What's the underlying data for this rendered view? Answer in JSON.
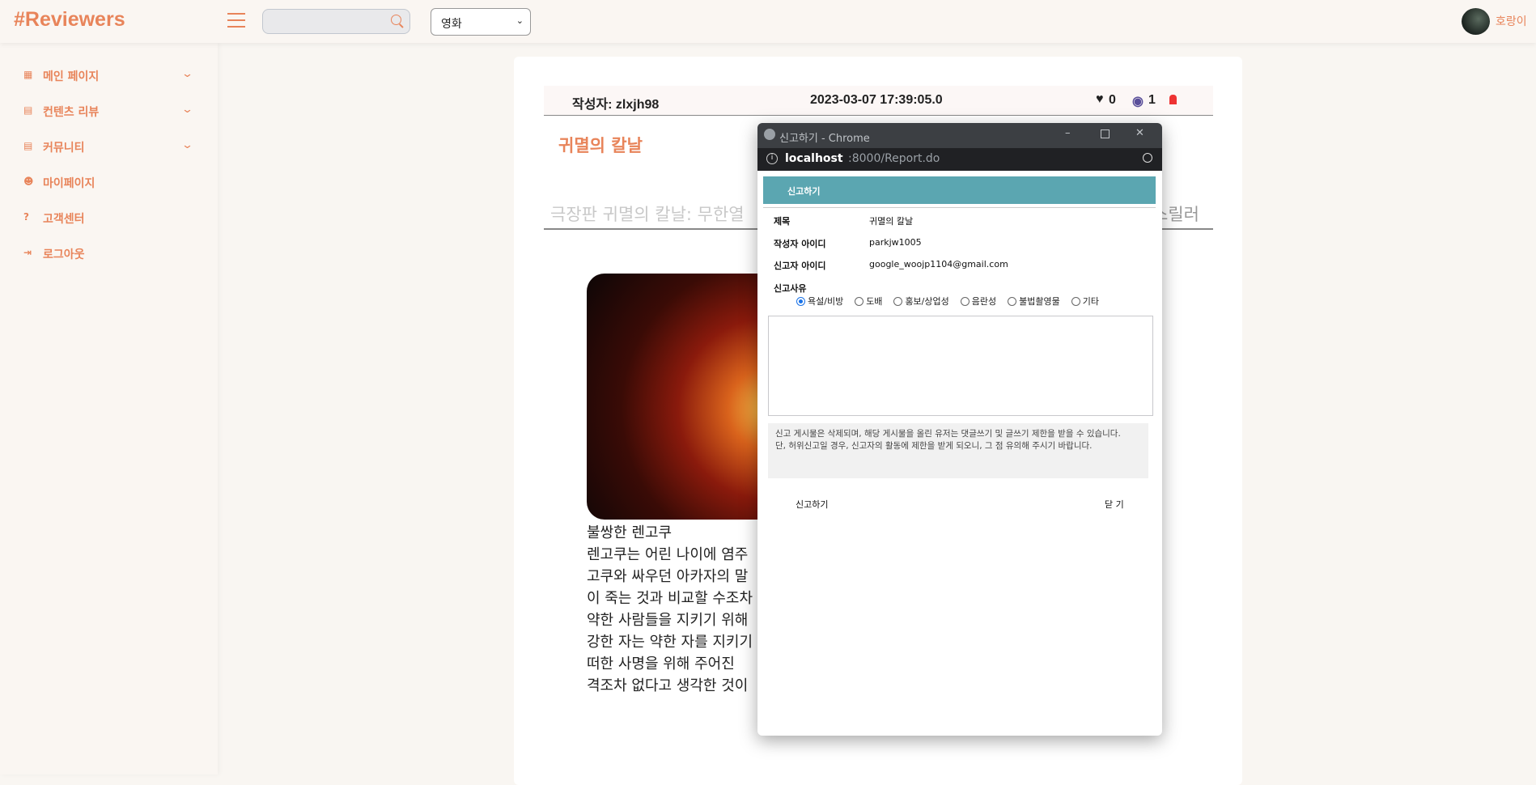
{
  "header": {
    "logo": "#Reviewers",
    "search_placeholder": "",
    "category": "영화",
    "user_name": "호랑이"
  },
  "sidebar": {
    "items": [
      {
        "label": "메인 페이지",
        "icon": "grid-icon",
        "has_submenu": true
      },
      {
        "label": "컨텐츠 리뷰",
        "icon": "list-icon",
        "has_submenu": true
      },
      {
        "label": "커뮤니티",
        "icon": "notebook-icon",
        "has_submenu": true
      },
      {
        "label": "마이페이지",
        "icon": "user-icon",
        "has_submenu": false
      },
      {
        "label": "고객센터",
        "icon": "help-icon",
        "has_submenu": false
      },
      {
        "label": "로그아웃",
        "icon": "logout-icon",
        "has_submenu": false
      }
    ]
  },
  "post": {
    "author": "작성자: zlxjh98",
    "date": "2023-03-07 17:39:05.0",
    "likes": "0",
    "views": "1",
    "title": "귀멸의 칼날",
    "subtitle_left": "극장판 귀멸의 칼날: 무한열",
    "subtitle_right": "스릴러",
    "body_lines": [
      "불쌍한 렌고쿠",
      "렌고쿠는 어린 나이에 염주",
      "고쿠와 싸우던 아카자의 말",
      "이 죽는 것과 비교할 수조차",
      "약한 사람들을 지키기 위해",
      "강한 자는 약한 자를 지키기",
      "떠한 사명을 위해 주어진 ",
      "격조차 없다고 생각한 것이"
    ]
  },
  "popup": {
    "window_title": "신고하기 - Chrome",
    "url_host": "localhost",
    "url_rest": ":8000/Report.do",
    "header": "신고하기",
    "fields": [
      {
        "label": "제목",
        "value": "귀멸의 칼날"
      },
      {
        "label": "작성자 아이디",
        "value": "parkjw1005"
      },
      {
        "label": "신고자 아이디",
        "value": "google_woojp1104@gmail.com"
      }
    ],
    "reason_label": "신고사유",
    "reasons": [
      "욕설/비방",
      "도배",
      "홍보/상업성",
      "음란성",
      "불법촬영물",
      "기타"
    ],
    "selected_reason": "욕설/비방",
    "textarea_value": "",
    "notice_line1": "신고 게시물은 삭제되며, 해당 게시물을 올린 유저는 댓글쓰기 및 글쓰기 제한을 받을 수 있습니다.",
    "notice_line2": "단, 허위신고일 경우, 신고자의 활동에 제한을 받게 되오니, 그 점 유의해 주시기 바랍니다.",
    "submit_label": "신고하기",
    "close_label": "닫 기",
    "accent": "#5ba6b1"
  }
}
